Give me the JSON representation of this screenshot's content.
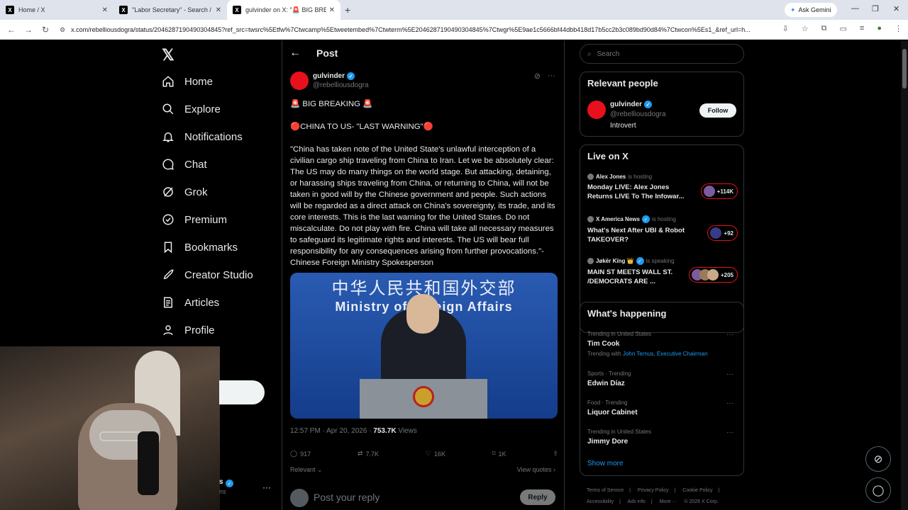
{
  "browser": {
    "tabs": [
      {
        "title": "Home / X",
        "active": false
      },
      {
        "title": "\"Labor Secretary\" - Search / X",
        "active": false
      },
      {
        "title": "gulvinder on X: \"🚨 BIG BREAKING",
        "active": true
      }
    ],
    "new_tab": "+",
    "ask_gemini": "Ask Gemini",
    "url": "x.com/rebelliousdogra/status/2046287190490304845?ref_src=twsrc%5Etfw%7Ctwcamp%5Etweetembed%7Ctwterm%5E2046287190490304845%7Ctwgr%5E9ae1c5666bf44dbb418d17b5cc2b3c089bd90d84%7Ctwcon%5Es1_&ref_url=h..."
  },
  "nav": {
    "items": [
      {
        "label": "Home",
        "icon": "home-icon"
      },
      {
        "label": "Explore",
        "icon": "search-icon"
      },
      {
        "label": "Notifications",
        "icon": "bell-icon"
      },
      {
        "label": "Chat",
        "icon": "chat-icon"
      },
      {
        "label": "Grok",
        "icon": "grok-icon"
      },
      {
        "label": "Premium",
        "icon": "premium-icon"
      },
      {
        "label": "Bookmarks",
        "icon": "bookmark-icon"
      },
      {
        "label": "Creator Studio",
        "icon": "rocket-icon"
      },
      {
        "label": "Articles",
        "icon": "articles-icon"
      },
      {
        "label": "Profile",
        "icon": "person-icon"
      }
    ],
    "account_name_fragment": "s",
    "account_handle_fragment": "ns",
    "more_dots": "···"
  },
  "header": {
    "title": "Post"
  },
  "post": {
    "author_name": "gulvinder",
    "author_handle": "@rebelliousdogra",
    "line1": "🚨 BIG BREAKING 🚨",
    "line2": "🔴CHINA TO US- \"LAST WARNING\"🔴",
    "body": "\"China has taken note of the United State's unlawful interception of a civilian cargo ship traveling from China to Iran. Let we be absolutely clear: The US may do many things on the world stage. But attacking, detaining, or harassing ships traveling from China, or returning to China, will not be taken in good will by the Chinese government and people. Such actions will be regarded as a direct attack on China's sovereignty, its trade, and its core interests. This is the last warning for the United States. Do not miscalculate. Do not play with fire. China will take all necessary measures to safeguard its legitimate rights and interests. The US will bear full responsibility for any consequences arising from further provocations.\"- Chinese Foreign Ministry Spokesperson",
    "media_text_cn": "中华人民共和国外交部",
    "media_text_en": "Ministry of Foreign Affairs",
    "timestamp": "12:57 PM · Apr 20, 2026 · ",
    "views_count": "753.7K",
    "views_label": " Views",
    "replies": "917",
    "reposts": "7.7K",
    "likes": "16K",
    "bookmarks": "1K",
    "sort_label": "Relevant",
    "view_quotes": "View quotes",
    "reply_placeholder": "Post your reply",
    "reply_button": "Reply"
  },
  "sidebar": {
    "search_placeholder": "Search",
    "relevant_people": {
      "title": "Relevant people",
      "name": "gulvinder",
      "handle": "@rebelliousdogra",
      "bio": "Introvert",
      "follow_label": "Follow"
    },
    "live": {
      "title": "Live on X",
      "items": [
        {
          "host": "Alex Jones",
          "status": "is hosting",
          "title": "Monday LIVE: Alex Jones Returns LIVE To The Infowar...",
          "count": "+114K"
        },
        {
          "host": "X America News",
          "status": "is hosting",
          "title": "What's Next After UBI & Robot TAKEOVER?",
          "count": "+92"
        },
        {
          "host": "Jøkër Kïng 👑",
          "status": "is speaking",
          "title": "MAIN ST MEETS WALL ST. /DEMOCRATS ARE ...",
          "count": "+205"
        }
      ]
    },
    "happening": {
      "title": "What's happening",
      "trends": [
        {
          "context": "Trending in United States",
          "topic": "Tim Cook",
          "with_prefix": "Trending with ",
          "with": "John Ternus, Executive Chairman"
        },
        {
          "context": "Sports · Trending",
          "topic": "Edwin Díaz"
        },
        {
          "context": "Food · Trending",
          "topic": "Liquor Cabinet"
        },
        {
          "context": "Trending in United States",
          "topic": "Jimmy Dore"
        }
      ],
      "show_more": "Show more"
    },
    "footer": [
      "Terms of Service",
      "|",
      "Privacy Policy",
      "|",
      "Cookie Policy",
      "|",
      "Accessibility",
      "|",
      "Ads info",
      "|",
      "More ···",
      "© 2026 X Corp."
    ]
  },
  "colors": {
    "accent": "#1d9bf0",
    "background": "#000000",
    "live_border": "#e8101c",
    "avatar_red": "#e8101c"
  }
}
